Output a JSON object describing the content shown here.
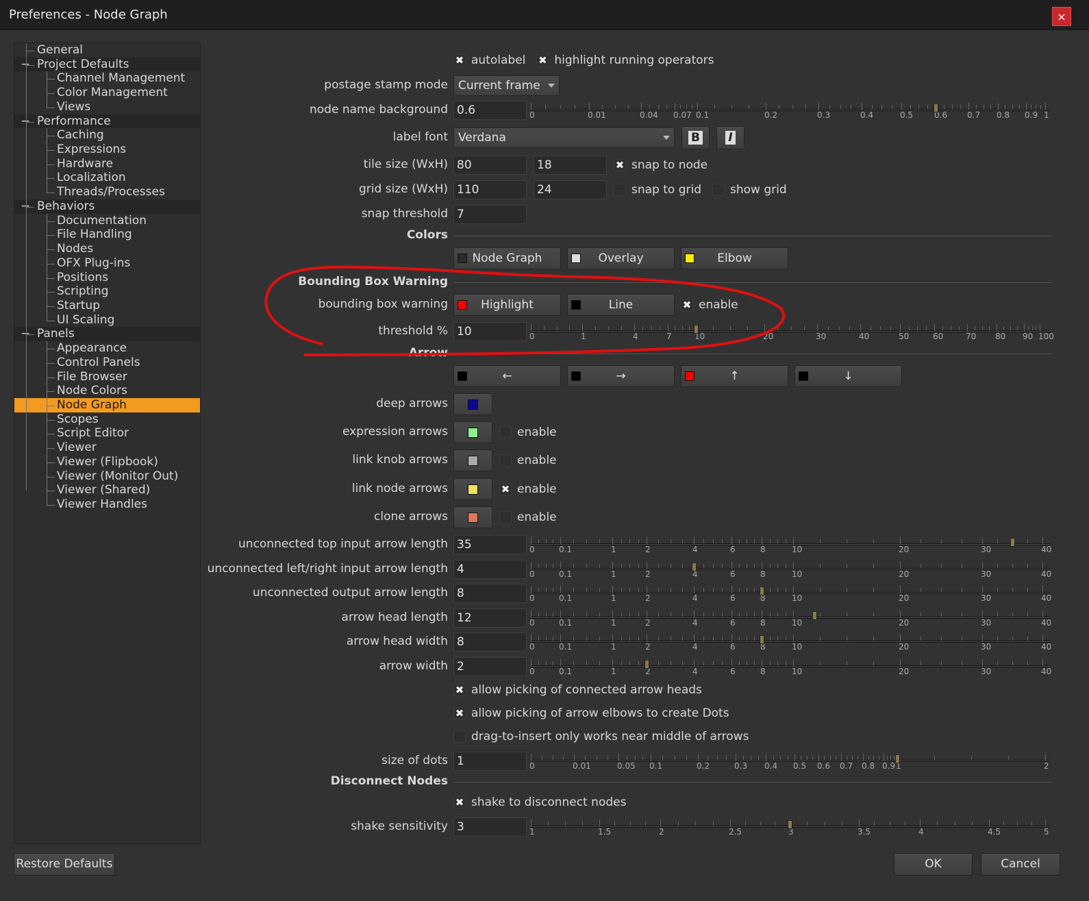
{
  "window": {
    "title": "Preferences - Node Graph",
    "close_label": "×"
  },
  "tree": [
    {
      "label": "General",
      "level": 0
    },
    {
      "label": "Project Defaults",
      "level": 0,
      "section": true
    },
    {
      "label": "Channel Management",
      "level": 1
    },
    {
      "label": "Color Management",
      "level": 1
    },
    {
      "label": "Views",
      "level": 1
    },
    {
      "label": "Performance",
      "level": 0,
      "section": true
    },
    {
      "label": "Caching",
      "level": 1
    },
    {
      "label": "Expressions",
      "level": 1
    },
    {
      "label": "Hardware",
      "level": 1
    },
    {
      "label": "Localization",
      "level": 1
    },
    {
      "label": "Threads/Processes",
      "level": 1
    },
    {
      "label": "Behaviors",
      "level": 0,
      "section": true
    },
    {
      "label": "Documentation",
      "level": 1
    },
    {
      "label": "File Handling",
      "level": 1
    },
    {
      "label": "Nodes",
      "level": 1
    },
    {
      "label": "OFX Plug-ins",
      "level": 1
    },
    {
      "label": "Positions",
      "level": 1
    },
    {
      "label": "Scripting",
      "level": 1
    },
    {
      "label": "Startup",
      "level": 1
    },
    {
      "label": "UI Scaling",
      "level": 1
    },
    {
      "label": "Panels",
      "level": 0,
      "section": true
    },
    {
      "label": "Appearance",
      "level": 1
    },
    {
      "label": "Control Panels",
      "level": 1
    },
    {
      "label": "File Browser",
      "level": 1
    },
    {
      "label": "Node Colors",
      "level": 1
    },
    {
      "label": "Node Graph",
      "level": 1,
      "selected": true
    },
    {
      "label": "Scopes",
      "level": 1
    },
    {
      "label": "Script Editor",
      "level": 1
    },
    {
      "label": "Viewer",
      "level": 1
    },
    {
      "label": "Viewer (Flipbook)",
      "level": 1
    },
    {
      "label": "Viewer (Monitor Out)",
      "level": 1
    },
    {
      "label": "Viewer (Shared)",
      "level": 1
    },
    {
      "label": "Viewer Handles",
      "level": 1
    }
  ],
  "scales": {
    "unit": [
      "0",
      "0.01",
      "0.04",
      "0.07",
      "0.1",
      "0.2",
      "0.3",
      "0.4",
      "0.5",
      "0.6",
      "0.7",
      "0.8",
      "0.9",
      "1"
    ],
    "percent": [
      "0",
      "1",
      "4",
      "7",
      "10",
      "20",
      "30",
      "40",
      "50",
      "60",
      "70",
      "80",
      "90",
      "100"
    ],
    "arrow": [
      "0",
      "0.1",
      "1",
      "2",
      "4",
      "6",
      "8",
      "10",
      "20",
      "30",
      "40"
    ],
    "dots": [
      "0",
      "0.01",
      "0.05",
      "0.1",
      "0.2",
      "0.3",
      "0.4",
      "0.5",
      "0.6",
      "0.7",
      "0.8",
      "0.9",
      "1",
      "2"
    ],
    "shake": [
      "1",
      "1.5",
      "2",
      "2.5",
      "3",
      "3.5",
      "4",
      "4.5",
      "5"
    ]
  },
  "rows": [
    {
      "type": "checks",
      "checks": [
        {
          "label": "autolabel",
          "checked": true
        },
        {
          "label": "highlight running operators",
          "checked": true
        }
      ]
    },
    {
      "type": "dropdown",
      "label": "postage stamp mode",
      "value": "Current frame"
    },
    {
      "type": "slider",
      "label": "node name background",
      "value": "0.6",
      "scale": "unit"
    },
    {
      "type": "font",
      "label": "label font",
      "value": "Verdana",
      "bold_label": "B",
      "italic_label": "I"
    },
    {
      "type": "two",
      "label": "tile size (WxH)",
      "values": [
        "80",
        "18"
      ],
      "checks": [
        {
          "label": "snap to node",
          "checked": true
        }
      ]
    },
    {
      "type": "two",
      "label": "grid size (WxH)",
      "values": [
        "110",
        "24"
      ],
      "checks": [
        {
          "label": "snap to grid",
          "checked": false
        },
        {
          "label": "show grid",
          "checked": false
        }
      ]
    },
    {
      "type": "input",
      "label": "snap threshold",
      "value": "7"
    },
    {
      "type": "header",
      "label": "Colors"
    },
    {
      "type": "buttons",
      "label": "",
      "buttons": [
        {
          "label": "Node Graph",
          "color": "#2a2a2a"
        },
        {
          "label": "Overlay",
          "color": "#dddddd"
        },
        {
          "label": "Elbow",
          "color": "#ffee00"
        }
      ]
    },
    {
      "type": "header",
      "label": "Bounding Box Warning"
    },
    {
      "type": "buttons",
      "label": "bounding box warning",
      "buttons": [
        {
          "label": "Highlight",
          "color": "#ff0000"
        },
        {
          "label": "Line",
          "color": "#000000"
        }
      ],
      "checks": [
        {
          "label": "enable",
          "checked": true
        }
      ]
    },
    {
      "type": "slider",
      "label": "threshold %",
      "value": "10",
      "scale": "percent"
    },
    {
      "type": "header",
      "label": "Arrow"
    },
    {
      "type": "buttons",
      "label": "",
      "buttons": [
        {
          "label": "←",
          "color": "#000000"
        },
        {
          "label": "→",
          "color": "#000000"
        },
        {
          "label": "↑",
          "color": "#ff0000"
        },
        {
          "label": "↓",
          "color": "#000000"
        }
      ]
    },
    {
      "type": "swatch",
      "label": "deep arrows",
      "color": "#0a0a90"
    },
    {
      "type": "swatch",
      "label": "expression arrows",
      "color": "#8cf08c",
      "checks": [
        {
          "label": "enable",
          "checked": false
        }
      ]
    },
    {
      "type": "swatch",
      "label": "link knob arrows",
      "color": "#aaaaaa",
      "checks": [
        {
          "label": "enable",
          "checked": false
        }
      ]
    },
    {
      "type": "swatch",
      "label": "link node arrows",
      "color": "#f0e060",
      "checks": [
        {
          "label": "enable",
          "checked": true
        }
      ]
    },
    {
      "type": "swatch",
      "label": "clone arrows",
      "color": "#e07858",
      "checks": [
        {
          "label": "enable",
          "checked": false
        }
      ]
    },
    {
      "type": "slider",
      "label": "unconnected top input arrow length",
      "value": "35",
      "scale": "arrow"
    },
    {
      "type": "slider",
      "label": "unconnected left/right input arrow length",
      "value": "4",
      "scale": "arrow"
    },
    {
      "type": "slider",
      "label": "unconnected output arrow length",
      "value": "8",
      "scale": "arrow"
    },
    {
      "type": "slider",
      "label": "arrow head length",
      "value": "12",
      "scale": "arrow"
    },
    {
      "type": "slider",
      "label": "arrow head width",
      "value": "8",
      "scale": "arrow"
    },
    {
      "type": "slider",
      "label": "arrow width",
      "value": "2",
      "scale": "arrow"
    },
    {
      "type": "checks",
      "checks": [
        {
          "label": "allow picking of connected arrow heads",
          "checked": true
        }
      ]
    },
    {
      "type": "checks",
      "checks": [
        {
          "label": "allow picking of arrow elbows to create Dots",
          "checked": true
        }
      ]
    },
    {
      "type": "checks",
      "checks": [
        {
          "label": "drag-to-insert only works near middle of arrows",
          "checked": false
        }
      ]
    },
    {
      "type": "slider",
      "label": "size of dots",
      "value": "1",
      "scale": "dots"
    },
    {
      "type": "header",
      "label": "Disconnect Nodes"
    },
    {
      "type": "checks",
      "checks": [
        {
          "label": "shake to disconnect nodes",
          "checked": true
        }
      ]
    },
    {
      "type": "slider",
      "label": "shake sensitivity",
      "value": "3",
      "scale": "shake"
    }
  ],
  "footer": {
    "restore_label": "Restore Defaults",
    "ok_label": "OK",
    "cancel_label": "Cancel"
  },
  "annotation_color": "#e01010"
}
